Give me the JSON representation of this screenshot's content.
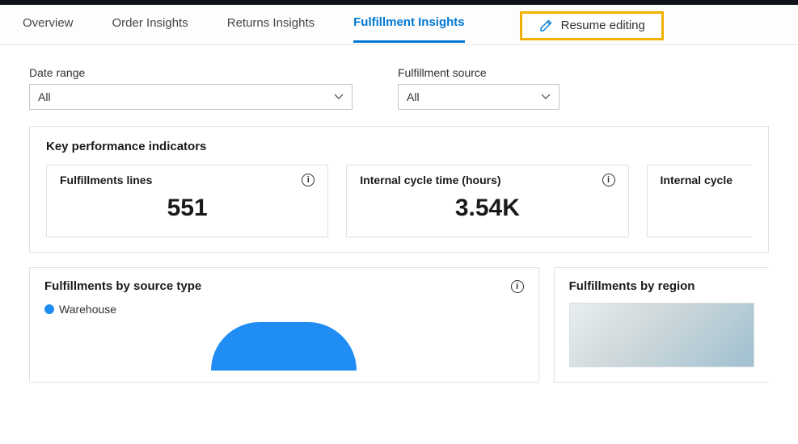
{
  "tabs": {
    "overview": "Overview",
    "order": "Order Insights",
    "returns": "Returns Insights",
    "fulfillment": "Fulfillment Insights"
  },
  "resume_editing": "Resume editing",
  "filters": {
    "date_range": {
      "label": "Date range",
      "value": "All"
    },
    "fulfillment_source": {
      "label": "Fulfillment source",
      "value": "All"
    }
  },
  "kpi": {
    "panel_title": "Key performance indicators",
    "cards": [
      {
        "title": "Fulfillments lines",
        "value": "551"
      },
      {
        "title": "Internal cycle time (hours)",
        "value": "3.54K"
      },
      {
        "title": "Internal cycle",
        "value": ""
      }
    ]
  },
  "panels": {
    "source_type": {
      "title": "Fulfillments by source type",
      "legend": "Warehouse"
    },
    "region": {
      "title": "Fulfillments by region"
    }
  },
  "colors": {
    "accent": "#0078d4",
    "highlight": "#f2b100",
    "chart_blue": "#1f8df4"
  },
  "chart_data": {
    "type": "pie",
    "title": "Fulfillments by source type",
    "series": [
      {
        "name": "Warehouse",
        "value": 100,
        "color": "#1f8df4"
      }
    ]
  }
}
